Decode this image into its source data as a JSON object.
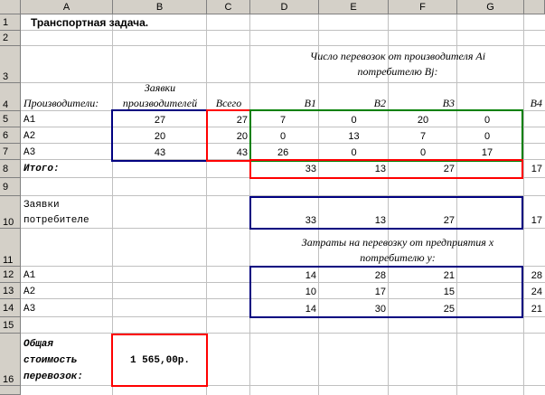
{
  "columns": [
    "A",
    "B",
    "C",
    "D",
    "E",
    "F",
    "G"
  ],
  "rows": [
    "1",
    "2",
    "3",
    "4",
    "5",
    "6",
    "7",
    "8",
    "9",
    "10",
    "11",
    "12",
    "13",
    "14",
    "15",
    "16"
  ],
  "title": "Транспортная задача.",
  "shipments_header_line1": "Число перевозок от производителя Ai",
  "shipments_header_line2": "потребителю Bj:",
  "producers_label": "Производители:",
  "requests_line1": "Заявки",
  "requests_line2": "производителей",
  "total_label": "Всего",
  "consumers": [
    "B1",
    "B2",
    "B3",
    "B4"
  ],
  "producers": [
    "A1",
    "A2",
    "A3"
  ],
  "producer_requests": [
    "27",
    "20",
    "43"
  ],
  "producer_totals": [
    "27",
    "20",
    "43"
  ],
  "shipments": [
    [
      "7",
      "0",
      "20",
      "0"
    ],
    [
      "0",
      "13",
      "7",
      "0"
    ],
    [
      "26",
      "0",
      "0",
      "17"
    ]
  ],
  "itogo_label": "Итого:",
  "itogo_values": [
    "33",
    "13",
    "27",
    "17"
  ],
  "consumer_requests_line1": "Заявки",
  "consumer_requests_line2": "потребителе",
  "consumer_requests": [
    "33",
    "13",
    "27",
    "17"
  ],
  "costs_header_line1": "Затраты на перевозку от предприятия х",
  "costs_header_line2": "потребителю у:",
  "cost_producers": [
    "A1",
    "A2",
    "A3"
  ],
  "costs": [
    [
      "14",
      "28",
      "21",
      "28"
    ],
    [
      "10",
      "17",
      "15",
      "24"
    ],
    [
      "14",
      "30",
      "25",
      "21"
    ]
  ],
  "total_cost_line1": "Общая",
  "total_cost_line2": "стоимость",
  "total_cost_line3": "перевозок:",
  "total_cost_value": "1 565,00р."
}
